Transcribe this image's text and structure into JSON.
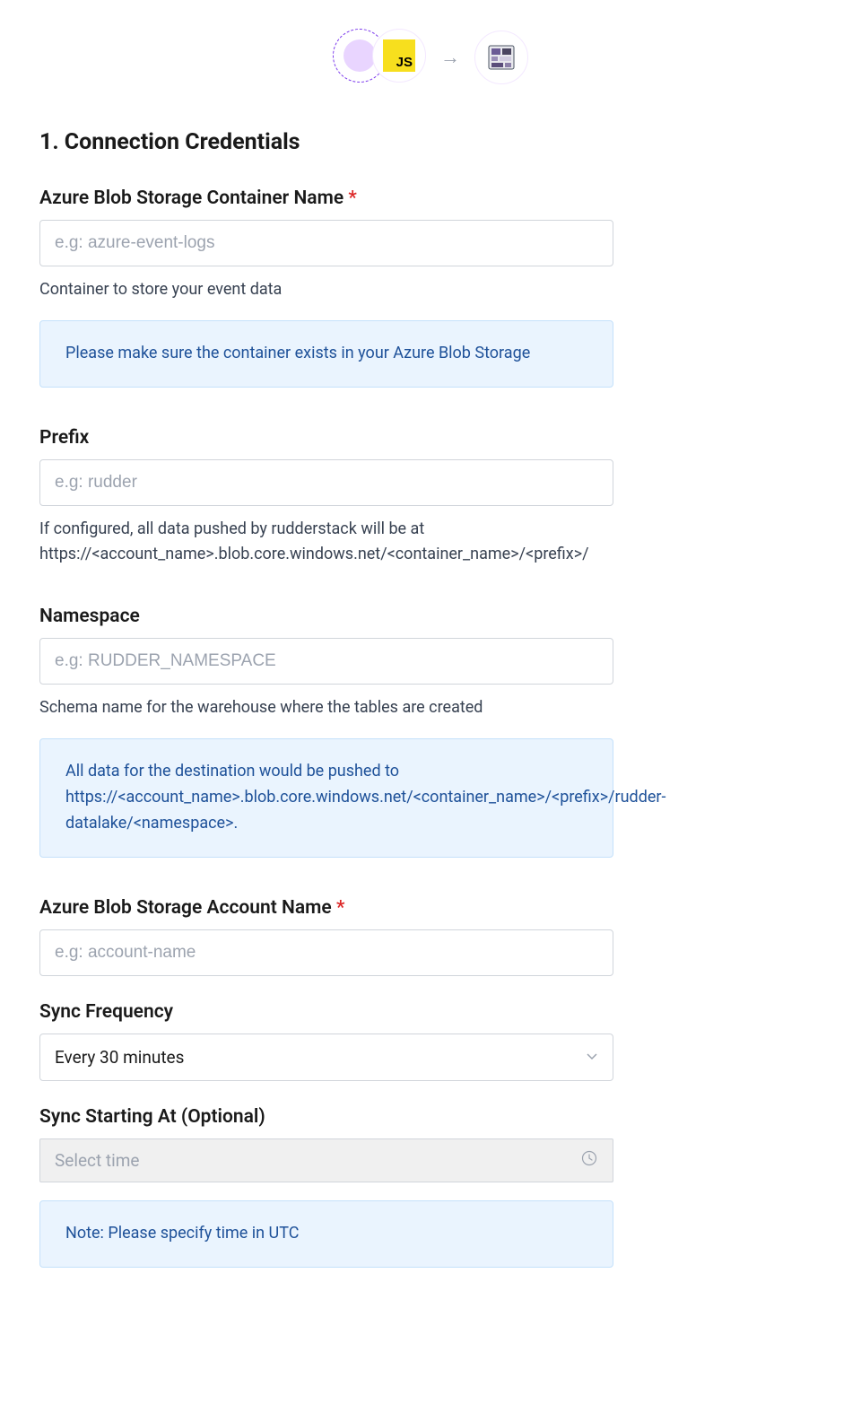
{
  "header": {
    "source_badge": "JS",
    "arrow": "→"
  },
  "section": {
    "title": "1. Connection Credentials"
  },
  "fields": {
    "container": {
      "label": "Azure Blob Storage Container Name",
      "required": "*",
      "placeholder": "e.g: azure-event-logs",
      "help": "Container to store your event data",
      "info": "Please make sure the container exists in your Azure Blob Storage"
    },
    "prefix": {
      "label": "Prefix",
      "placeholder": "e.g: rudder",
      "help": "If configured, all data pushed by rudderstack will be at https://<account_name>.blob.core.windows.net/<container_name>/<prefix>/"
    },
    "namespace": {
      "label": "Namespace",
      "placeholder": "e.g: RUDDER_NAMESPACE",
      "help": "Schema name for the warehouse where the tables are created",
      "info": "All data for the destination would be pushed to https://<account_name>.blob.core.windows.net/<container_name>/<prefix>/rudder-datalake/<namespace>."
    },
    "account_name": {
      "label": "Azure Blob Storage Account Name",
      "required": "*",
      "placeholder": "e.g: account-name"
    },
    "sync_frequency": {
      "label": "Sync Frequency",
      "value": "Every 30 minutes"
    },
    "sync_start": {
      "label": "Sync Starting At (Optional)",
      "placeholder": "Select time",
      "info": "Note: Please specify time in UTC"
    }
  }
}
